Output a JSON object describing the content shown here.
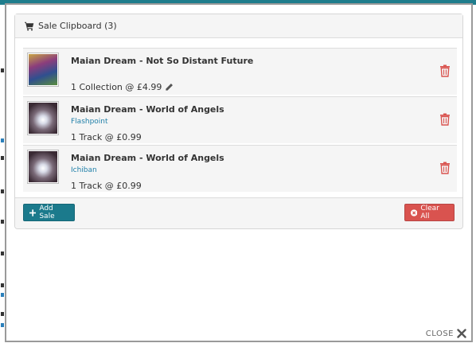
{
  "panel": {
    "title": "Sale Clipboard (3)"
  },
  "items": [
    {
      "title": "Maian Dream - Not So Distant Future",
      "subtitle": "",
      "summary": "1 Collection @ £4.99"
    },
    {
      "title": "Maian Dream - World of Angels",
      "subtitle": "Flashpoint",
      "summary": "1 Track @ £0.99"
    },
    {
      "title": "Maian Dream - World of Angels",
      "subtitle": "Ichiban",
      "summary": "1 Track @ £0.99"
    }
  ],
  "footer": {
    "add_label": "Add Sale",
    "clear_label": "Clear All"
  },
  "close_label": "CLOSE",
  "colors": {
    "accent": "#1b7a8c",
    "danger": "#d9534f",
    "link": "#1f7fa8"
  }
}
